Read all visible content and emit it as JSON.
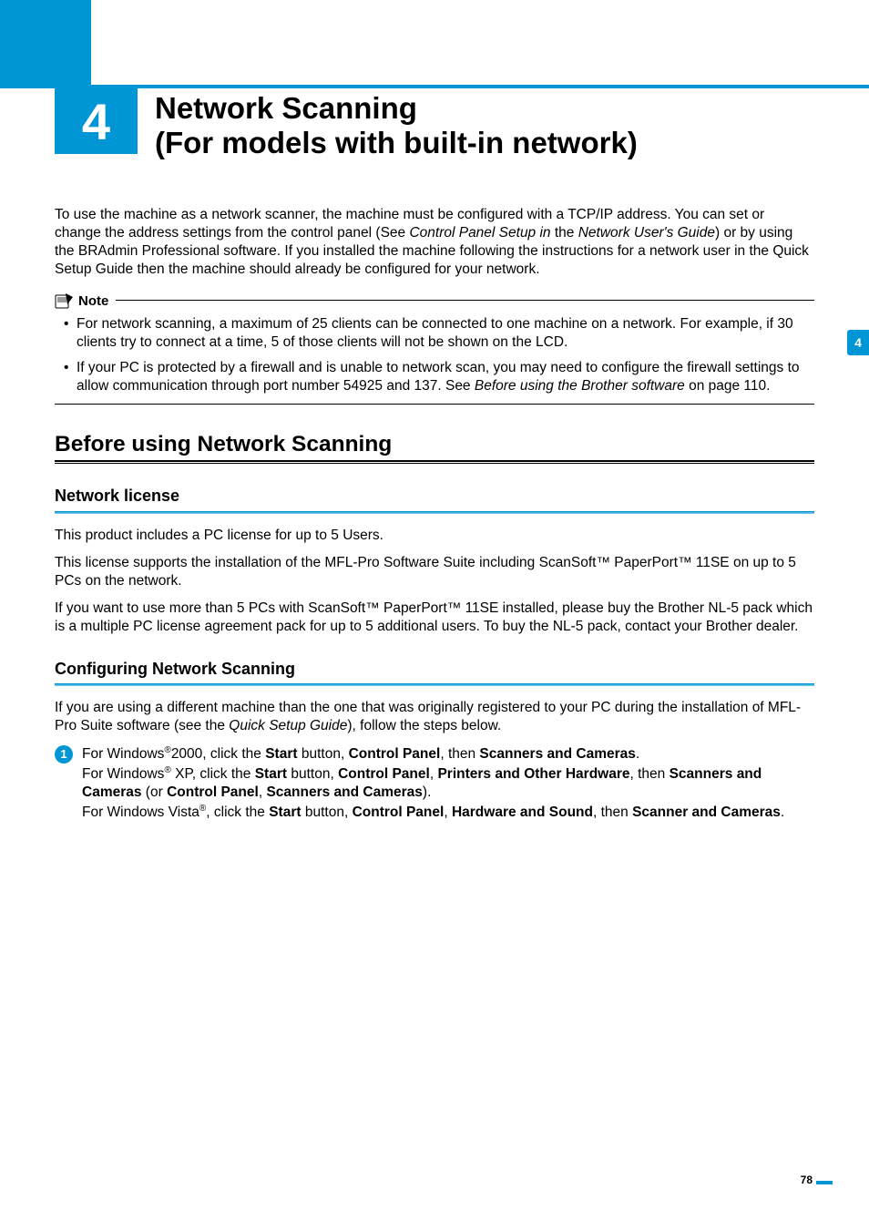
{
  "chapter": {
    "number": "4",
    "title_line1": "Network Scanning",
    "title_line2": "(For models with built-in network)"
  },
  "side_tab": "4",
  "intro": {
    "part1": "To use the machine as a network scanner, the machine must be configured with a TCP/IP address. You can set or change the address settings from the control panel (See ",
    "italic1": "Control Panel Setup in",
    "part2": " the ",
    "italic2": "Network User's Guide",
    "part3": ") or by using the BRAdmin Professional software. If you installed the machine following the instructions for a network user in the Quick Setup Guide then the machine should already be configured for your network."
  },
  "note": {
    "label": "Note",
    "items": [
      {
        "text": "For network scanning, a maximum of 25 clients can be connected to one machine on a network. For example, if 30 clients try to connect at a time, 5 of those clients will not be shown on the LCD."
      },
      {
        "part1": "If your PC is protected by a firewall and is unable to network scan, you may need to configure the firewall settings to allow communication through port number 54925 and 137. See ",
        "italic": "Before using the Brother software",
        "part2": " on page 110."
      }
    ]
  },
  "sections": {
    "h1": "Before using Network Scanning",
    "network_license": {
      "heading": "Network license",
      "p1": "This product includes a PC license for up to 5 Users.",
      "p2": "This license supports the installation of the MFL-Pro Software Suite including ScanSoft™ PaperPort™ 11SE on up to 5 PCs on the network.",
      "p3": "If you want to use more than 5 PCs with ScanSoft™ PaperPort™ 11SE installed, please buy the Brother NL-5 pack which is a multiple PC license agreement pack for up to 5 additional users. To buy the NL-5 pack, contact your Brother dealer."
    },
    "configuring": {
      "heading": "Configuring Network Scanning",
      "intro_part1": "If you are using a different machine than the one that was originally registered to your PC during the installation of MFL-Pro Suite software (see the ",
      "intro_italic": "Quick Setup Guide",
      "intro_part2": "), follow the steps below.",
      "step1": {
        "badge": "1",
        "win2000_a": "For Windows",
        "win2000_b": "2000, click the ",
        "win2000_start": "Start",
        "win2000_c": " button, ",
        "win2000_cp": "Control Panel",
        "win2000_d": ", then ",
        "win2000_sc": "Scanners and Cameras",
        "win2000_e": ".",
        "winxp_a": "For Windows",
        "winxp_b": " XP, click the ",
        "winxp_start": "Start",
        "winxp_c": " button, ",
        "winxp_cp": "Control Panel",
        "winxp_d": ", ",
        "winxp_poh": "Printers and Other Hardware",
        "winxp_e": ", then ",
        "winxp_sc": "Scanners and Cameras",
        "winxp_f": " (or ",
        "winxp_cp2": "Control Panel",
        "winxp_g": ", ",
        "winxp_sc2": "Scanners and Cameras",
        "winxp_h": ").",
        "vista_a": "For Windows Vista",
        "vista_b": ", click the ",
        "vista_start": "Start",
        "vista_c": " button, ",
        "vista_cp": "Control Panel",
        "vista_d": ", ",
        "vista_hs": "Hardware and Sound",
        "vista_e": ", then ",
        "vista_sc": "Scanner and Cameras",
        "vista_f": "."
      }
    }
  },
  "page_number": "78"
}
